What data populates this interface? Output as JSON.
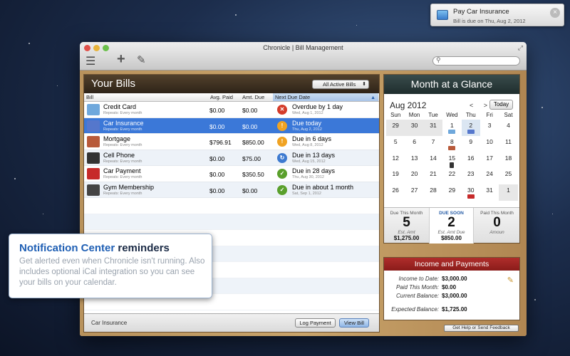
{
  "notification": {
    "title": "Pay Car Insurance",
    "message": "Bill is due on Thu, Aug 2, 2012",
    "close_glyph": "×"
  },
  "window": {
    "title": "Chronicle | Bill Management",
    "toolbar": {
      "list_glyph": "☰",
      "add_glyph": "+",
      "edit_glyph": "✎",
      "search_glyph": "⚲",
      "fullscreen_glyph": "⤢"
    }
  },
  "bills_panel": {
    "title": "Your Bills",
    "filter": "All Active Bills",
    "filter_chevron": "⬍",
    "columns": {
      "bill": "Bill",
      "avg": "Avg. Paid",
      "amt": "Amt. Due",
      "due": "Next Due Date"
    },
    "sort_arrow": "▲",
    "rows": [
      {
        "name": "Credit Card",
        "repeat": "Repeats: Every month",
        "avg": "$0.00",
        "amt": "$0.00",
        "due": "Overdue by 1 day",
        "due_date": "Wed, Aug 1, 2012",
        "status_glyph": "✕",
        "status_color": "#d43c2a",
        "icon": "credit-card-icon",
        "icon_color": "#6fa8dc"
      },
      {
        "name": "Car Insurance",
        "repeat": "Repeats: Every month",
        "avg": "$0.00",
        "amt": "$0.00",
        "due": "Due today",
        "due_date": "Thu, Aug 2, 2012",
        "status_glyph": "!",
        "status_color": "#f0a323",
        "icon": "umbrella-icon",
        "icon_color": "#5577cc"
      },
      {
        "name": "Mortgage",
        "repeat": "Repeats: Every month",
        "avg": "$796.91",
        "amt": "$850.00",
        "due": "Due in 6 days",
        "due_date": "Wed, Aug 8, 2012",
        "status_glyph": "!",
        "status_color": "#f0a323",
        "icon": "house-icon",
        "icon_color": "#b85a3a"
      },
      {
        "name": "Cell Phone",
        "repeat": "Repeats: Every month",
        "avg": "$0.00",
        "amt": "$75.00",
        "due": "Due in 13 days",
        "due_date": "Wed, Aug 15, 2012",
        "status_glyph": "↻",
        "status_color": "#3d7ad0",
        "icon": "phone-icon",
        "icon_color": "#333333"
      },
      {
        "name": "Car Payment",
        "repeat": "Repeats: Every month",
        "avg": "$0.00",
        "amt": "$350.50",
        "due": "Due in 28 days",
        "due_date": "Thu, Aug 30, 2012",
        "status_glyph": "✓",
        "status_color": "#5aa02c",
        "icon": "car-icon",
        "icon_color": "#c62a2a"
      },
      {
        "name": "Gym Membership",
        "repeat": "Repeats: Every month",
        "avg": "$0.00",
        "amt": "$0.00",
        "due": "Due in about 1 month",
        "due_date": "Sat, Sep 1, 2012",
        "status_glyph": "✓",
        "status_color": "#5aa02c",
        "icon": "dumbbell-icon",
        "icon_color": "#444444"
      }
    ],
    "footer_label": "Car Insurance",
    "log_payment": "Log Payment",
    "view_bill": "View Bill"
  },
  "glance": {
    "title": "Month at a Glance",
    "month": "Aug 2012",
    "nav": "< >",
    "today": "Today",
    "dow": [
      "Sun",
      "Mon",
      "Tue",
      "Wed",
      "Thu",
      "Fri",
      "Sat"
    ],
    "weeks": [
      [
        "29",
        "30",
        "31",
        "1",
        "2",
        "3",
        "4"
      ],
      [
        "5",
        "6",
        "7",
        "8",
        "9",
        "10",
        "11"
      ],
      [
        "12",
        "13",
        "14",
        "15",
        "16",
        "17",
        "18"
      ],
      [
        "19",
        "20",
        "21",
        "22",
        "23",
        "24",
        "25"
      ],
      [
        "26",
        "27",
        "28",
        "29",
        "30",
        "31",
        "1"
      ]
    ],
    "stats": {
      "due_month_label": "Due This Month",
      "due_month_count": "5",
      "due_month_sub": "Est. Amt",
      "due_month_val": "$1,275.00",
      "due_soon_label": "DUE SOON",
      "due_soon_count": "2",
      "due_soon_sub": "Est. Amt Due",
      "due_soon_val": "$850.00",
      "paid_label": "Paid This Month",
      "paid_count": "0",
      "paid_sub": "Amoun"
    }
  },
  "income": {
    "title": "Income and Payments",
    "income_label": "Income to Date:",
    "income_val": "$3,000.00",
    "paid_label": "Paid This Month:",
    "paid_val": "$0.00",
    "balance_label": "Current Balance:",
    "balance_val": "$3,000.00",
    "expected_label": "Expected Balance:",
    "expected_val": "$1,725.00",
    "edit_glyph": "✎"
  },
  "help_button": "Get Help or Send Feedback",
  "callout": {
    "head_blue": "Notification Center",
    "head_dark": " reminders",
    "body": "Get alerted even when Chronicle isn't running. Also includes optional iCal integration so you can see your bills on your calendar."
  }
}
